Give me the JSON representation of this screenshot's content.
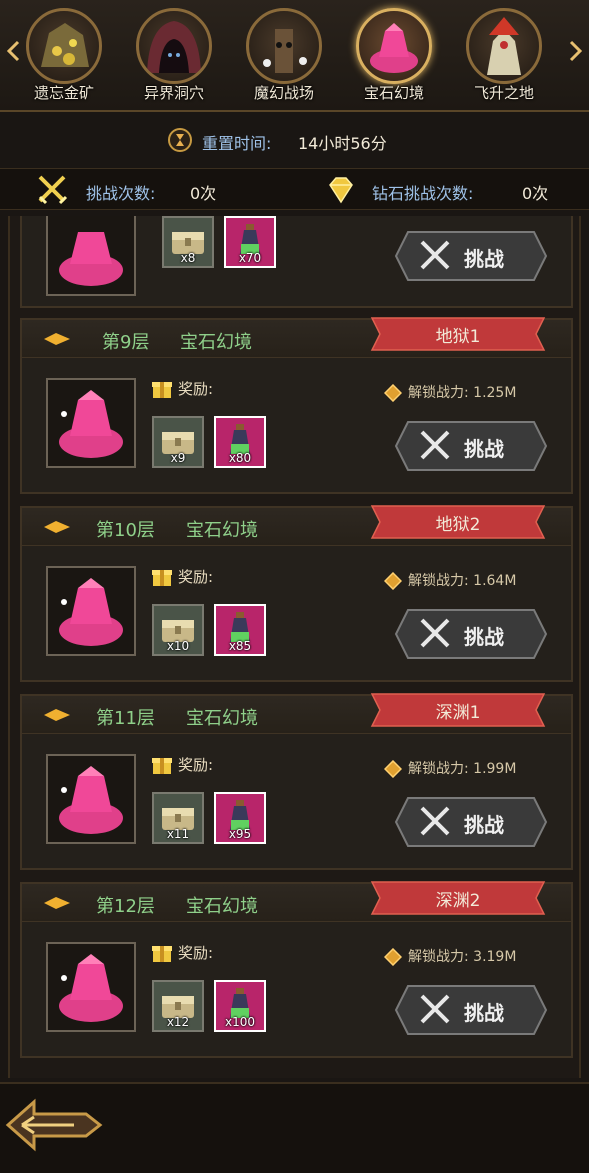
{
  "tabs": [
    {
      "label": "遗忘金矿",
      "icon": "gold-ore-icon"
    },
    {
      "label": "异界洞穴",
      "icon": "cave-icon"
    },
    {
      "label": "魔幻战场",
      "icon": "haunted-tree-icon"
    },
    {
      "label": "宝石幻境",
      "icon": "gem-icon",
      "active": true
    },
    {
      "label": "飞升之地",
      "icon": "ascension-icon"
    }
  ],
  "reset": {
    "label": "重置时间:",
    "value": "14小时56分"
  },
  "counts": {
    "challenge_label": "挑战次数:",
    "challenge_value": "0次",
    "diamond_label": "钻石挑战次数:",
    "diamond_value": "0次"
  },
  "reward_label": "奖励:",
  "challenge_button": "挑战",
  "partial_card": {
    "items": [
      {
        "qty": "x8"
      },
      {
        "qty": "x70"
      }
    ]
  },
  "cards": [
    {
      "floor": "第9层",
      "realm": "宝石幻境",
      "difficulty": "地狱1",
      "unlock": "解锁战力: 1.25M",
      "chest_qty": "x9",
      "potion_qty": "x80"
    },
    {
      "floor": "第10层",
      "realm": "宝石幻境",
      "difficulty": "地狱2",
      "unlock": "解锁战力: 1.64M",
      "chest_qty": "x10",
      "potion_qty": "x85"
    },
    {
      "floor": "第11层",
      "realm": "宝石幻境",
      "difficulty": "深渊1",
      "unlock": "解锁战力: 1.99M",
      "chest_qty": "x11",
      "potion_qty": "x95"
    },
    {
      "floor": "第12层",
      "realm": "宝石幻境",
      "difficulty": "深渊2",
      "unlock": "解锁战力: 3.19M",
      "chest_qty": "x12",
      "potion_qty": "x100"
    }
  ],
  "colors": {
    "accent_green": "#8fd08a",
    "ribbon_red": "#c0393a",
    "label_blue": "#9fc2e8",
    "gold": "#d9b060"
  }
}
